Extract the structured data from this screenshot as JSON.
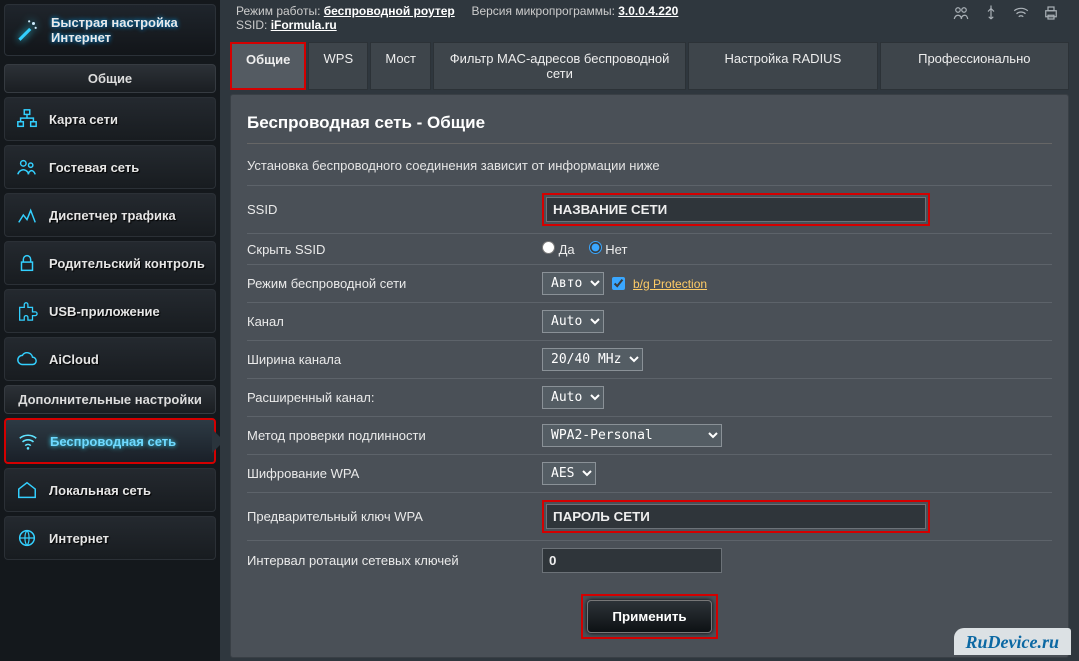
{
  "sidebar": {
    "quick_setup": "Быстрая настройка\nИнтернет",
    "general_head": "Общие",
    "general_items": [
      "Карта сети",
      "Гостевая сеть",
      "Диспетчер трафика",
      "Родительский контроль",
      "USB-приложение",
      "AiCloud"
    ],
    "advanced_head": "Дополнительные настройки",
    "advanced_items": [
      "Беспроводная сеть",
      "Локальная сеть",
      "Интернет"
    ]
  },
  "top": {
    "mode_label": "Режим работы: ",
    "mode_value": "беспроводной роутер",
    "fw_label": "Версия микропрограммы: ",
    "fw_value": "3.0.0.4.220",
    "ssid_label": "SSID: ",
    "ssid_value": "iFormula.ru"
  },
  "tabs": [
    "Общие",
    "WPS",
    "Мост",
    "Фильтр MAC-адресов беспроводной сети",
    "Настройка RADIUS",
    "Профессионально"
  ],
  "panel": {
    "title": "Беспроводная сеть - Общие",
    "subtitle": "Установка беспроводного соединения зависит от информации ниже",
    "fields": {
      "ssid": {
        "label": "SSID",
        "value": "НАЗВАНИЕ СЕТИ"
      },
      "hide_ssid": {
        "label": "Скрыть SSID",
        "yes": "Да",
        "no": "Нет"
      },
      "wmode": {
        "label": "Режим беспроводной сети",
        "value": "Авто",
        "bg": "b/g Protection"
      },
      "channel": {
        "label": "Канал",
        "value": "Auto"
      },
      "width": {
        "label": "Ширина канала",
        "value": "20/40 MHz"
      },
      "extchan": {
        "label": "Расширенный канал:",
        "value": "Auto"
      },
      "auth": {
        "label": "Метод проверки подлинности",
        "value": "WPA2-Personal"
      },
      "enc": {
        "label": "Шифрование WPA",
        "value": "AES"
      },
      "psk": {
        "label": "Предварительный ключ WPA",
        "value": "ПАРОЛЬ СЕТИ"
      },
      "rotate": {
        "label": "Интервал ротации сетевых ключей",
        "value": "0"
      }
    },
    "apply": "Применить"
  },
  "watermark": "RuDevice.ru"
}
